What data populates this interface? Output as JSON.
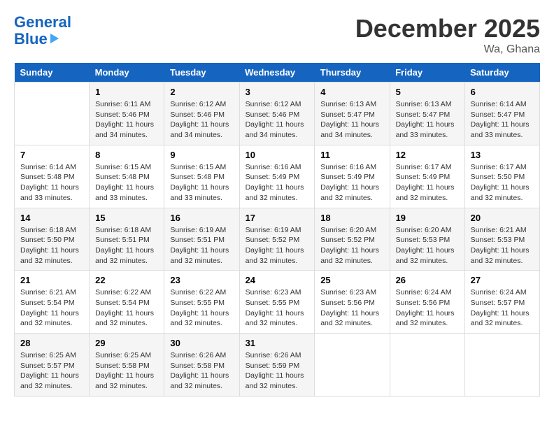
{
  "header": {
    "logo_line1_part1": "General",
    "logo_line1_part2": "",
    "logo_line2": "Blue",
    "month_title": "December 2025",
    "location": "Wa, Ghana"
  },
  "days_of_week": [
    "Sunday",
    "Monday",
    "Tuesday",
    "Wednesday",
    "Thursday",
    "Friday",
    "Saturday"
  ],
  "weeks": [
    [
      {
        "day": "",
        "info": ""
      },
      {
        "day": "1",
        "info": "Sunrise: 6:11 AM\nSunset: 5:46 PM\nDaylight: 11 hours\nand 34 minutes."
      },
      {
        "day": "2",
        "info": "Sunrise: 6:12 AM\nSunset: 5:46 PM\nDaylight: 11 hours\nand 34 minutes."
      },
      {
        "day": "3",
        "info": "Sunrise: 6:12 AM\nSunset: 5:46 PM\nDaylight: 11 hours\nand 34 minutes."
      },
      {
        "day": "4",
        "info": "Sunrise: 6:13 AM\nSunset: 5:47 PM\nDaylight: 11 hours\nand 34 minutes."
      },
      {
        "day": "5",
        "info": "Sunrise: 6:13 AM\nSunset: 5:47 PM\nDaylight: 11 hours\nand 33 minutes."
      },
      {
        "day": "6",
        "info": "Sunrise: 6:14 AM\nSunset: 5:47 PM\nDaylight: 11 hours\nand 33 minutes."
      }
    ],
    [
      {
        "day": "7",
        "info": "Sunrise: 6:14 AM\nSunset: 5:48 PM\nDaylight: 11 hours\nand 33 minutes."
      },
      {
        "day": "8",
        "info": "Sunrise: 6:15 AM\nSunset: 5:48 PM\nDaylight: 11 hours\nand 33 minutes."
      },
      {
        "day": "9",
        "info": "Sunrise: 6:15 AM\nSunset: 5:48 PM\nDaylight: 11 hours\nand 33 minutes."
      },
      {
        "day": "10",
        "info": "Sunrise: 6:16 AM\nSunset: 5:49 PM\nDaylight: 11 hours\nand 32 minutes."
      },
      {
        "day": "11",
        "info": "Sunrise: 6:16 AM\nSunset: 5:49 PM\nDaylight: 11 hours\nand 32 minutes."
      },
      {
        "day": "12",
        "info": "Sunrise: 6:17 AM\nSunset: 5:49 PM\nDaylight: 11 hours\nand 32 minutes."
      },
      {
        "day": "13",
        "info": "Sunrise: 6:17 AM\nSunset: 5:50 PM\nDaylight: 11 hours\nand 32 minutes."
      }
    ],
    [
      {
        "day": "14",
        "info": "Sunrise: 6:18 AM\nSunset: 5:50 PM\nDaylight: 11 hours\nand 32 minutes."
      },
      {
        "day": "15",
        "info": "Sunrise: 6:18 AM\nSunset: 5:51 PM\nDaylight: 11 hours\nand 32 minutes."
      },
      {
        "day": "16",
        "info": "Sunrise: 6:19 AM\nSunset: 5:51 PM\nDaylight: 11 hours\nand 32 minutes."
      },
      {
        "day": "17",
        "info": "Sunrise: 6:19 AM\nSunset: 5:52 PM\nDaylight: 11 hours\nand 32 minutes."
      },
      {
        "day": "18",
        "info": "Sunrise: 6:20 AM\nSunset: 5:52 PM\nDaylight: 11 hours\nand 32 minutes."
      },
      {
        "day": "19",
        "info": "Sunrise: 6:20 AM\nSunset: 5:53 PM\nDaylight: 11 hours\nand 32 minutes."
      },
      {
        "day": "20",
        "info": "Sunrise: 6:21 AM\nSunset: 5:53 PM\nDaylight: 11 hours\nand 32 minutes."
      }
    ],
    [
      {
        "day": "21",
        "info": "Sunrise: 6:21 AM\nSunset: 5:54 PM\nDaylight: 11 hours\nand 32 minutes."
      },
      {
        "day": "22",
        "info": "Sunrise: 6:22 AM\nSunset: 5:54 PM\nDaylight: 11 hours\nand 32 minutes."
      },
      {
        "day": "23",
        "info": "Sunrise: 6:22 AM\nSunset: 5:55 PM\nDaylight: 11 hours\nand 32 minutes."
      },
      {
        "day": "24",
        "info": "Sunrise: 6:23 AM\nSunset: 5:55 PM\nDaylight: 11 hours\nand 32 minutes."
      },
      {
        "day": "25",
        "info": "Sunrise: 6:23 AM\nSunset: 5:56 PM\nDaylight: 11 hours\nand 32 minutes."
      },
      {
        "day": "26",
        "info": "Sunrise: 6:24 AM\nSunset: 5:56 PM\nDaylight: 11 hours\nand 32 minutes."
      },
      {
        "day": "27",
        "info": "Sunrise: 6:24 AM\nSunset: 5:57 PM\nDaylight: 11 hours\nand 32 minutes."
      }
    ],
    [
      {
        "day": "28",
        "info": "Sunrise: 6:25 AM\nSunset: 5:57 PM\nDaylight: 11 hours\nand 32 minutes."
      },
      {
        "day": "29",
        "info": "Sunrise: 6:25 AM\nSunset: 5:58 PM\nDaylight: 11 hours\nand 32 minutes."
      },
      {
        "day": "30",
        "info": "Sunrise: 6:26 AM\nSunset: 5:58 PM\nDaylight: 11 hours\nand 32 minutes."
      },
      {
        "day": "31",
        "info": "Sunrise: 6:26 AM\nSunset: 5:59 PM\nDaylight: 11 hours\nand 32 minutes."
      },
      {
        "day": "",
        "info": ""
      },
      {
        "day": "",
        "info": ""
      },
      {
        "day": "",
        "info": ""
      }
    ]
  ]
}
